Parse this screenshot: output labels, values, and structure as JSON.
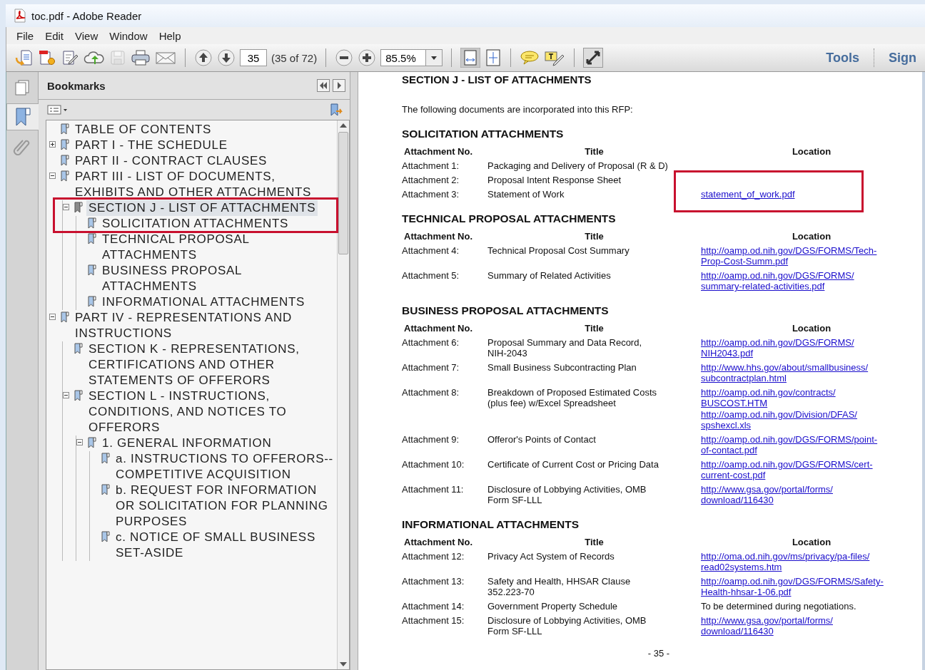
{
  "window": {
    "title": "toc.pdf - Adobe Reader"
  },
  "menu": [
    "File",
    "Edit",
    "View",
    "Window",
    "Help"
  ],
  "toolbar": {
    "page_number": "35",
    "page_count": "(35 of 72)",
    "zoom": "85.5%",
    "panes": [
      "Tools",
      "Sign"
    ]
  },
  "side_tabs": [
    {
      "kind": "pages",
      "selected": false
    },
    {
      "kind": "bookmarks",
      "selected": true
    },
    {
      "kind": "attachments",
      "selected": false
    }
  ],
  "bookmarks": {
    "title": "Bookmarks",
    "items": [
      {
        "label": "TABLE OF CONTENTS",
        "selected": false
      },
      {
        "label": "PART I - THE SCHEDULE",
        "selected": false,
        "expanded": false
      },
      {
        "label": "PART II - CONTRACT CLAUSES",
        "selected": false
      },
      {
        "label": "PART III - LIST OF DOCUMENTS, EXHIBITS AND OTHER ATTACHMENTS",
        "selected": false,
        "expanded": true,
        "children": [
          {
            "label": "SECTION J - LIST OF ATTACHMENTS",
            "selected": true,
            "annotated": true,
            "expanded": true,
            "children": [
              {
                "label": "SOLICITATION ATTACHMENTS",
                "selected": false
              },
              {
                "label": "TECHNICAL PROPOSAL ATTACHMENTS",
                "selected": false
              },
              {
                "label": "BUSINESS PROPOSAL ATTACHMENTS",
                "selected": false
              },
              {
                "label": "INFORMATIONAL ATTACHMENTS",
                "selected": false
              }
            ]
          }
        ]
      },
      {
        "label": "PART IV - REPRESENTATIONS AND INSTRUCTIONS",
        "selected": false,
        "expanded": true,
        "children": [
          {
            "label": "SECTION K - REPRESENTATIONS, CERTIFICATIONS AND OTHER STATEMENTS OF OFFERORS",
            "selected": false
          },
          {
            "label": "SECTION L - INSTRUCTIONS, CONDITIONS, AND NOTICES TO OFFERORS",
            "selected": false,
            "expanded": true,
            "children": [
              {
                "label": "1. GENERAL INFORMATION",
                "selected": false,
                "expanded": true,
                "children": [
                  {
                    "label": "a. INSTRUCTIONS TO OFFERORS--COMPETITIVE ACQUISITION",
                    "selected": false
                  },
                  {
                    "label": "b. REQUEST FOR INFORMATION OR SOLICITATION FOR PLANNING PURPOSES",
                    "selected": false
                  },
                  {
                    "label": "c. NOTICE OF SMALL BUSINESS SET-ASIDE",
                    "selected": false
                  }
                ]
              }
            ]
          }
        ]
      }
    ]
  },
  "document": {
    "heading": "SECTION J - LIST OF ATTACHMENTS",
    "intro": "The following documents are incorporated into this RFP:",
    "sections": [
      {
        "title": "SOLICITATION ATTACHMENTS",
        "columns": [
          "Attachment No.",
          "Title",
          "Location"
        ],
        "rows": [
          {
            "number": "Attachment 1:",
            "title": [
              "Packaging and Delivery of Proposal (R & D)"
            ]
          },
          {
            "number": "Attachment 2:",
            "title": [
              "Proposal Intent Response Sheet"
            ]
          },
          {
            "number": "Attachment 3:",
            "title": [
              "Statement of Work"
            ],
            "locations": [
              {
                "kind": "link",
                "annotated": true,
                "lines": [
                  "statement_of_work.pdf"
                ]
              }
            ]
          }
        ]
      },
      {
        "title": "TECHNICAL PROPOSAL ATTACHMENTS",
        "columns": [
          "Attachment No.",
          "Title",
          "Location"
        ],
        "rows": [
          {
            "number": "Attachment 4:",
            "title": [
              "Technical Proposal Cost Summary"
            ],
            "locations": [
              {
                "kind": "link",
                "lines": [
                  "http://oamp.od.nih.gov/DGS/FORMS/Tech-",
                  "Prop-Cost-Summ.pdf"
                ]
              }
            ]
          },
          {
            "number": "Attachment 5:",
            "title": [
              "Summary of Related Activities"
            ],
            "locations": [
              {
                "kind": "link",
                "lines": [
                  "http://oamp.od.nih.gov/DGS/FORMS/",
                  "summary-related-activities.pdf"
                ]
              }
            ]
          }
        ]
      },
      {
        "title": "BUSINESS PROPOSAL ATTACHMENTS",
        "columns": [
          "Attachment No.",
          "Title",
          "Location"
        ],
        "rows": [
          {
            "number": "Attachment 6:",
            "title": [
              "Proposal Summary and Data Record,",
              "NIH-2043"
            ],
            "locations": [
              {
                "kind": "link",
                "lines": [
                  "http://oamp.od.nih.gov/DGS/FORMS/",
                  "NIH2043.pdf"
                ]
              }
            ]
          },
          {
            "number": "Attachment 7:",
            "title": [
              "Small Business Subcontracting Plan"
            ],
            "locations": [
              {
                "kind": "link",
                "lines": [
                  "http://www.hhs.gov/about/smallbusiness/",
                  "subcontractplan.html"
                ]
              }
            ]
          },
          {
            "number": "Attachment 8:",
            "title": [
              "Breakdown of Proposed Estimated Costs",
              "(plus fee) w/Excel Spreadsheet"
            ],
            "locations": [
              {
                "kind": "link",
                "lines": [
                  "http://oamp.od.nih.gov/contracts/",
                  "BUSCOST.HTM"
                ]
              },
              {
                "kind": "link",
                "lines": [
                  "http://oamp.od.nih.gov/Division/DFAS/",
                  "spshexcl.xls"
                ]
              }
            ]
          },
          {
            "number": "Attachment 9:",
            "title": [
              "Offeror's Points of Contact"
            ],
            "locations": [
              {
                "kind": "link",
                "lines": [
                  "http://oamp.od.nih.gov/DGS/FORMS/point-",
                  "of-contact.pdf"
                ]
              }
            ]
          },
          {
            "number": "Attachment 10:",
            "title": [
              "Certificate of Current Cost or Pricing Data"
            ],
            "locations": [
              {
                "kind": "link",
                "lines": [
                  "http://oamp.od.nih.gov/DGS/FORMS/cert-",
                  "current-cost.pdf"
                ]
              }
            ]
          },
          {
            "number": "Attachment 11:",
            "title": [
              "Disclosure of Lobbying Activities, OMB",
              "Form SF-LLL"
            ],
            "locations": [
              {
                "kind": "link",
                "lines": [
                  "http://www.gsa.gov/portal/forms/",
                  "download/116430"
                ]
              }
            ]
          }
        ]
      },
      {
        "title": "INFORMATIONAL ATTACHMENTS",
        "columns": [
          "Attachment No.",
          "Title",
          "Location"
        ],
        "rows": [
          {
            "number": "Attachment 12:",
            "title": [
              "Privacy Act System of Records"
            ],
            "locations": [
              {
                "kind": "link",
                "lines": [
                  "http://oma.od.nih.gov/ms/privacy/pa-files/",
                  "read02systems.htm"
                ]
              }
            ]
          },
          {
            "number": "Attachment 13:",
            "title": [
              "Safety and Health, HHSAR Clause",
              "352.223-70"
            ],
            "locations": [
              {
                "kind": "link",
                "lines": [
                  "http://oamp.od.nih.gov/DGS/FORMS/Safety-",
                  "Health-hhsar-1-06.pdf"
                ]
              }
            ]
          },
          {
            "number": "Attachment 14:",
            "title": [
              "Government Property Schedule"
            ],
            "locations": [
              {
                "kind": "text",
                "lines": [
                  "To be determined during negotiations."
                ]
              }
            ]
          },
          {
            "number": "Attachment 15:",
            "title": [
              "Disclosure of Lobbying Activities, OMB",
              "Form SF-LLL"
            ],
            "locations": [
              {
                "kind": "link",
                "lines": [
                  "http://www.gsa.gov/portal/forms/",
                  "download/116430"
                ]
              }
            ]
          }
        ]
      }
    ],
    "page_label": "- 35 -"
  }
}
